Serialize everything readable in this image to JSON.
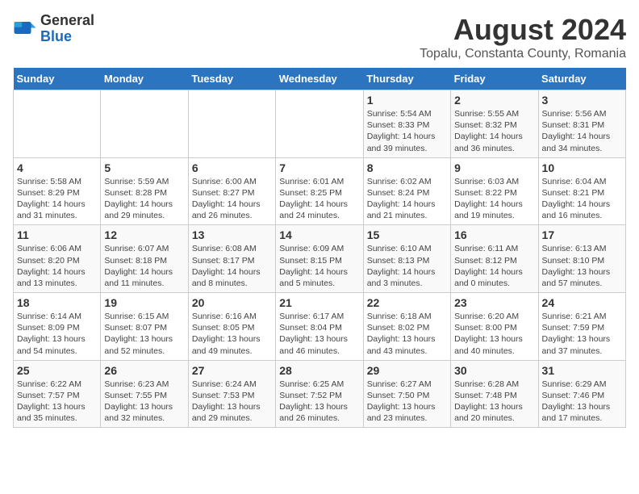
{
  "header": {
    "logo_general": "General",
    "logo_blue": "Blue",
    "month_year": "August 2024",
    "location": "Topalu, Constanta County, Romania"
  },
  "weekdays": [
    "Sunday",
    "Monday",
    "Tuesday",
    "Wednesday",
    "Thursday",
    "Friday",
    "Saturday"
  ],
  "weeks": [
    [
      {
        "day": "",
        "info": ""
      },
      {
        "day": "",
        "info": ""
      },
      {
        "day": "",
        "info": ""
      },
      {
        "day": "",
        "info": ""
      },
      {
        "day": "1",
        "info": "Sunrise: 5:54 AM\nSunset: 8:33 PM\nDaylight: 14 hours\nand 39 minutes."
      },
      {
        "day": "2",
        "info": "Sunrise: 5:55 AM\nSunset: 8:32 PM\nDaylight: 14 hours\nand 36 minutes."
      },
      {
        "day": "3",
        "info": "Sunrise: 5:56 AM\nSunset: 8:31 PM\nDaylight: 14 hours\nand 34 minutes."
      }
    ],
    [
      {
        "day": "4",
        "info": "Sunrise: 5:58 AM\nSunset: 8:29 PM\nDaylight: 14 hours\nand 31 minutes."
      },
      {
        "day": "5",
        "info": "Sunrise: 5:59 AM\nSunset: 8:28 PM\nDaylight: 14 hours\nand 29 minutes."
      },
      {
        "day": "6",
        "info": "Sunrise: 6:00 AM\nSunset: 8:27 PM\nDaylight: 14 hours\nand 26 minutes."
      },
      {
        "day": "7",
        "info": "Sunrise: 6:01 AM\nSunset: 8:25 PM\nDaylight: 14 hours\nand 24 minutes."
      },
      {
        "day": "8",
        "info": "Sunrise: 6:02 AM\nSunset: 8:24 PM\nDaylight: 14 hours\nand 21 minutes."
      },
      {
        "day": "9",
        "info": "Sunrise: 6:03 AM\nSunset: 8:22 PM\nDaylight: 14 hours\nand 19 minutes."
      },
      {
        "day": "10",
        "info": "Sunrise: 6:04 AM\nSunset: 8:21 PM\nDaylight: 14 hours\nand 16 minutes."
      }
    ],
    [
      {
        "day": "11",
        "info": "Sunrise: 6:06 AM\nSunset: 8:20 PM\nDaylight: 14 hours\nand 13 minutes."
      },
      {
        "day": "12",
        "info": "Sunrise: 6:07 AM\nSunset: 8:18 PM\nDaylight: 14 hours\nand 11 minutes."
      },
      {
        "day": "13",
        "info": "Sunrise: 6:08 AM\nSunset: 8:17 PM\nDaylight: 14 hours\nand 8 minutes."
      },
      {
        "day": "14",
        "info": "Sunrise: 6:09 AM\nSunset: 8:15 PM\nDaylight: 14 hours\nand 5 minutes."
      },
      {
        "day": "15",
        "info": "Sunrise: 6:10 AM\nSunset: 8:13 PM\nDaylight: 14 hours\nand 3 minutes."
      },
      {
        "day": "16",
        "info": "Sunrise: 6:11 AM\nSunset: 8:12 PM\nDaylight: 14 hours\nand 0 minutes."
      },
      {
        "day": "17",
        "info": "Sunrise: 6:13 AM\nSunset: 8:10 PM\nDaylight: 13 hours\nand 57 minutes."
      }
    ],
    [
      {
        "day": "18",
        "info": "Sunrise: 6:14 AM\nSunset: 8:09 PM\nDaylight: 13 hours\nand 54 minutes."
      },
      {
        "day": "19",
        "info": "Sunrise: 6:15 AM\nSunset: 8:07 PM\nDaylight: 13 hours\nand 52 minutes."
      },
      {
        "day": "20",
        "info": "Sunrise: 6:16 AM\nSunset: 8:05 PM\nDaylight: 13 hours\nand 49 minutes."
      },
      {
        "day": "21",
        "info": "Sunrise: 6:17 AM\nSunset: 8:04 PM\nDaylight: 13 hours\nand 46 minutes."
      },
      {
        "day": "22",
        "info": "Sunrise: 6:18 AM\nSunset: 8:02 PM\nDaylight: 13 hours\nand 43 minutes."
      },
      {
        "day": "23",
        "info": "Sunrise: 6:20 AM\nSunset: 8:00 PM\nDaylight: 13 hours\nand 40 minutes."
      },
      {
        "day": "24",
        "info": "Sunrise: 6:21 AM\nSunset: 7:59 PM\nDaylight: 13 hours\nand 37 minutes."
      }
    ],
    [
      {
        "day": "25",
        "info": "Sunrise: 6:22 AM\nSunset: 7:57 PM\nDaylight: 13 hours\nand 35 minutes."
      },
      {
        "day": "26",
        "info": "Sunrise: 6:23 AM\nSunset: 7:55 PM\nDaylight: 13 hours\nand 32 minutes."
      },
      {
        "day": "27",
        "info": "Sunrise: 6:24 AM\nSunset: 7:53 PM\nDaylight: 13 hours\nand 29 minutes."
      },
      {
        "day": "28",
        "info": "Sunrise: 6:25 AM\nSunset: 7:52 PM\nDaylight: 13 hours\nand 26 minutes."
      },
      {
        "day": "29",
        "info": "Sunrise: 6:27 AM\nSunset: 7:50 PM\nDaylight: 13 hours\nand 23 minutes."
      },
      {
        "day": "30",
        "info": "Sunrise: 6:28 AM\nSunset: 7:48 PM\nDaylight: 13 hours\nand 20 minutes."
      },
      {
        "day": "31",
        "info": "Sunrise: 6:29 AM\nSunset: 7:46 PM\nDaylight: 13 hours\nand 17 minutes."
      }
    ]
  ]
}
